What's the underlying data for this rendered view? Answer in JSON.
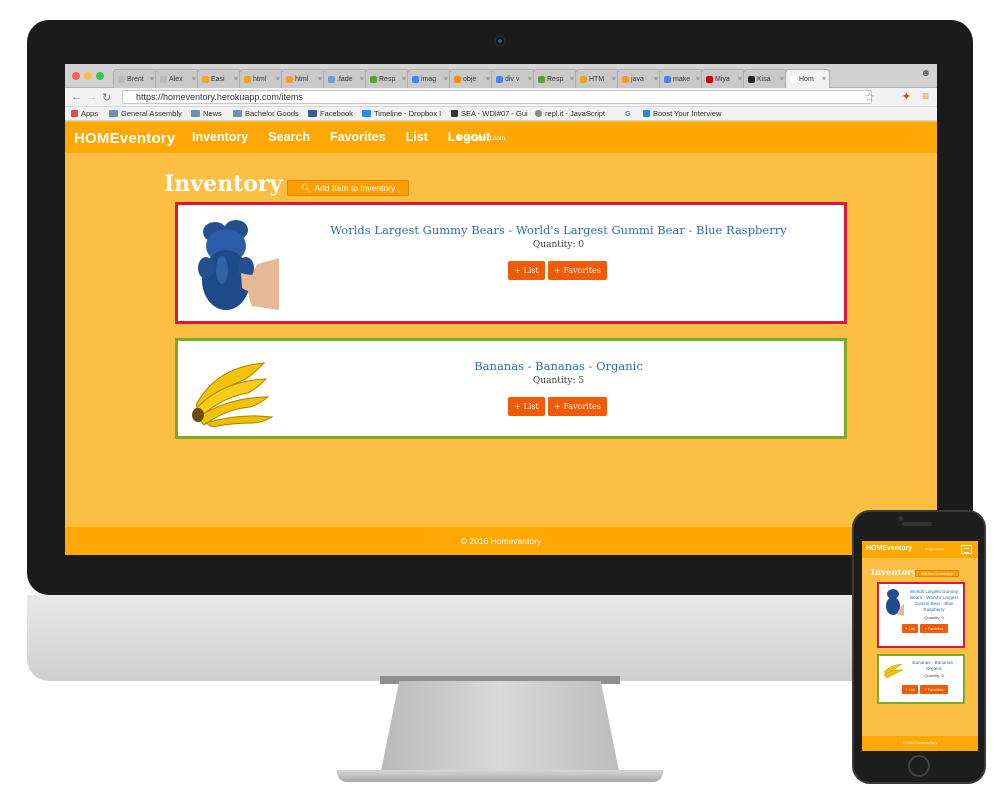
{
  "browser": {
    "tabs": [
      {
        "label": "Brent",
        "color": "#bbbbbb"
      },
      {
        "label": "Alex",
        "color": "#bbbbbb"
      },
      {
        "label": "Easi",
        "color": "#f5a623"
      },
      {
        "label": "html",
        "color": "#f0a020"
      },
      {
        "label": "html",
        "color": "#f0a020"
      },
      {
        "label": ".fade",
        "color": "#6a9fd8"
      },
      {
        "label": "Resp",
        "color": "#5aa02c"
      },
      {
        "label": "imag",
        "color": "#4285f4"
      },
      {
        "label": "obje",
        "color": "#ff8c00"
      },
      {
        "label": "div v",
        "color": "#4285f4"
      },
      {
        "label": "Resp",
        "color": "#5aa02c"
      },
      {
        "label": "HTM",
        "color": "#f0a020"
      },
      {
        "label": "java",
        "color": "#f0a020"
      },
      {
        "label": "make",
        "color": "#4285f4"
      },
      {
        "label": "Miya",
        "color": "#d0021b"
      },
      {
        "label": "Kisa",
        "color": "#222222"
      },
      {
        "label": "Hom",
        "color": "#ffffff"
      }
    ],
    "url": "https://homeventory.herokuapp.com/items",
    "bookmarks": [
      "Apps",
      "General Assembly",
      "News",
      "Bachelor Goods",
      "Facebook",
      "Timeline - Dropbox I",
      "SEA - WDI#07 - Gui",
      "repl.it - JavaScript",
      "G",
      "Boost Your Interview"
    ]
  },
  "app": {
    "brand": "HOMEventory",
    "nav": [
      "Inventory",
      "Search",
      "Favorites",
      "List",
      "Logout"
    ],
    "user": "test@test.com",
    "heading": "Inventory",
    "add_button": "Add Item to Inventory",
    "items": [
      {
        "title": "Worlds Largest Gummy Bears - World's Largest Gummi Bear - Blue Raspberry",
        "quantity": "Quantity: 0",
        "border": "#d9183b"
      },
      {
        "title": "Bananas - Bananas - Organic",
        "quantity": "Quantity: 5",
        "border": "#7cac27"
      }
    ],
    "list_button": "+ List",
    "fav_button": "+ Favorites",
    "footer": "© 2016 Homeventory"
  },
  "phone": {
    "items": [
      {
        "title": "Worlds Largest Gummy Bears - World's Largest Gummi Bear - Blue Raspberry",
        "quantity": "Quantity: 0"
      },
      {
        "title": "Bananas - Bananas - Organic",
        "quantity": "Quantity: 5"
      }
    ]
  },
  "colors": {
    "primary": "#ffa703",
    "background": "#fdbe44",
    "action": "#f15a06",
    "link": "#2b6db0"
  }
}
